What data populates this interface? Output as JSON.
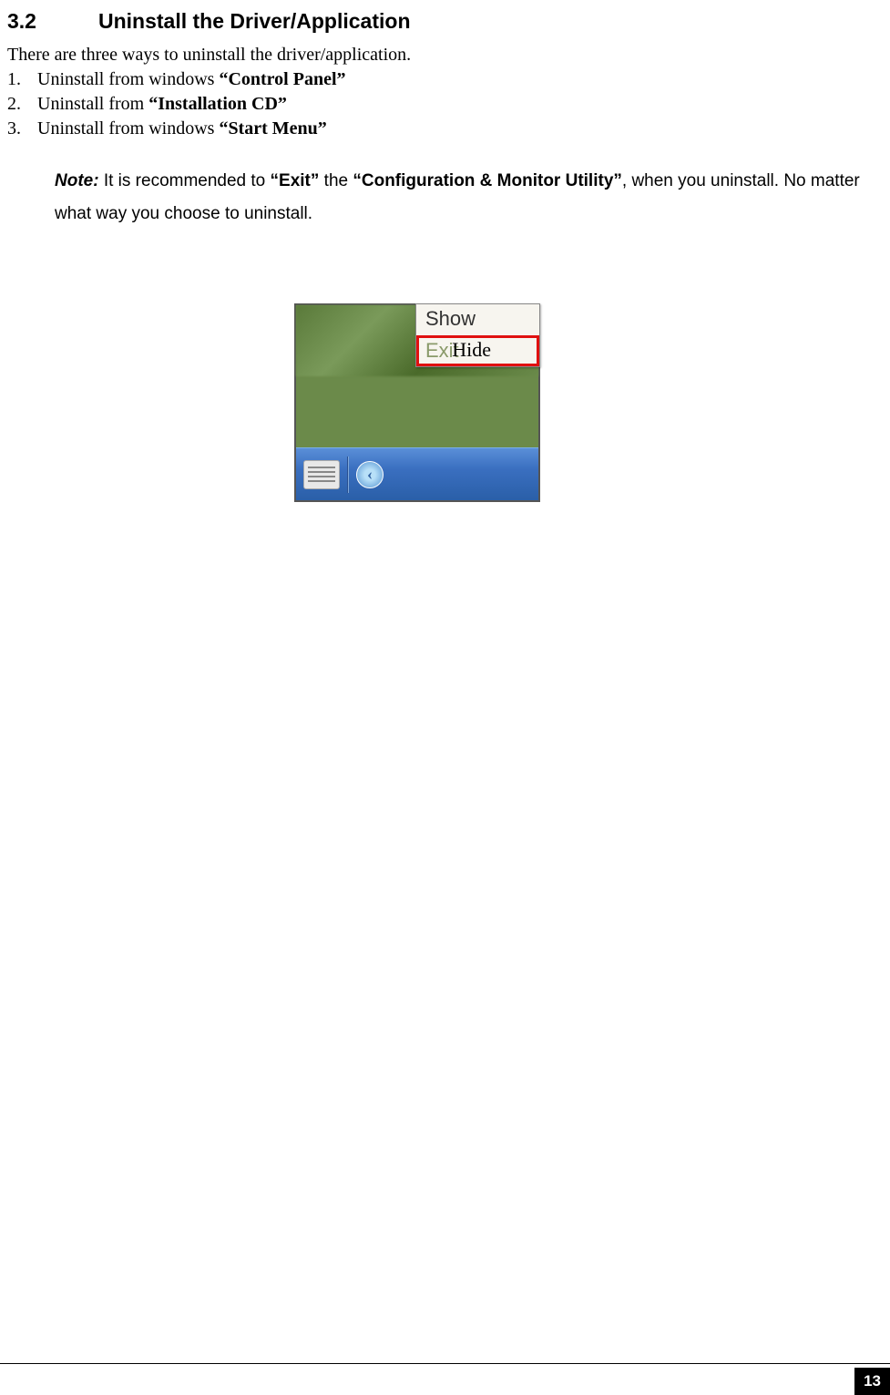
{
  "heading": {
    "number": "3.2",
    "title": "Uninstall the Driver/Application"
  },
  "intro": "There are three ways to uninstall the driver/application.",
  "list_items": [
    {
      "num": "1.",
      "prefix": "Uninstall from windows ",
      "bold": "“Control Panel”"
    },
    {
      "num": "2.",
      "prefix": "Uninstall from ",
      "bold": "“Installation CD”"
    },
    {
      "num": "3.",
      "prefix": "Uninstall from windows ",
      "bold": "“Start Menu”"
    }
  ],
  "note": {
    "label": "Note:",
    "part1": " It is recommended to ",
    "bold1": "“Exit”",
    "part2": " the ",
    "bold2": "“Configuration & Monitor Utility”",
    "part3": ", when you uninstall. No matter what way you choose to uninstall."
  },
  "menu": {
    "item1": "Show",
    "item2": "Exit",
    "overlay_label": "Hide",
    "arrow_glyph": "‹"
  },
  "page_number": "13"
}
